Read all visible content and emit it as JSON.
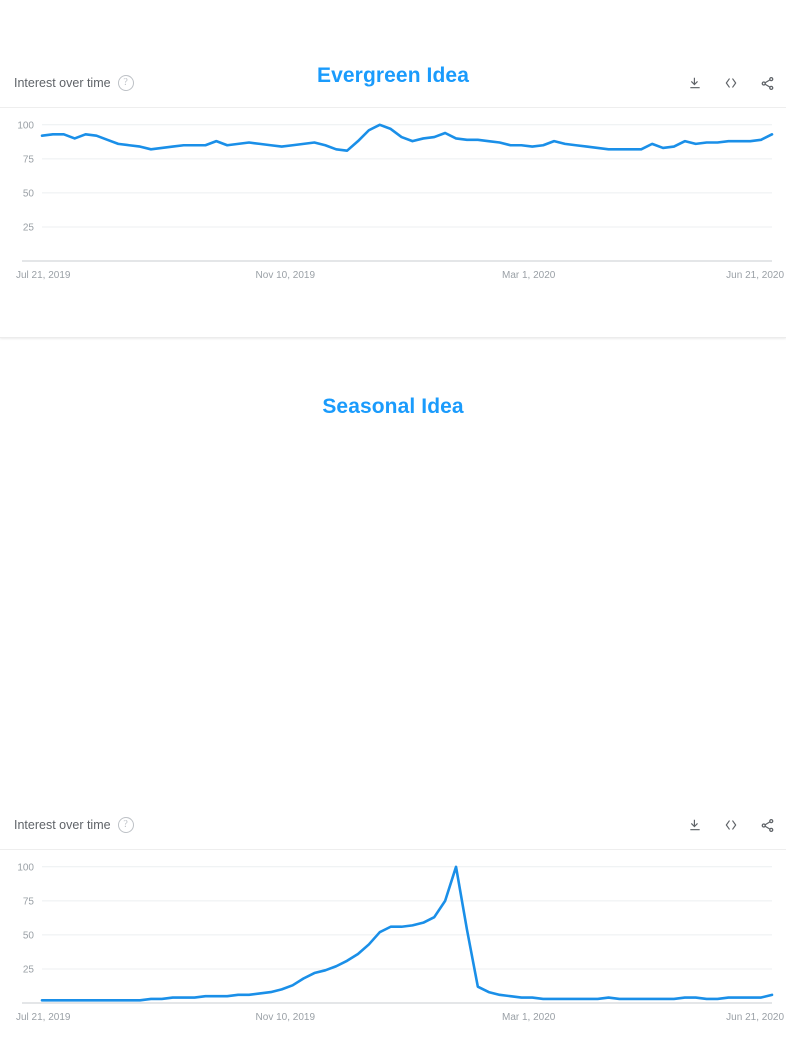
{
  "panels": [
    {
      "title": "Evergreen Idea",
      "header": {
        "label": "Interest over time",
        "help_icon": "help-circle-icon",
        "help_glyph": "?",
        "tools": [
          {
            "name": "download-icon",
            "label": "Download"
          },
          {
            "name": "embed-code-icon",
            "label": "Embed"
          },
          {
            "name": "share-icon",
            "label": "Share"
          }
        ]
      }
    },
    {
      "title": "Seasonal Idea",
      "header": {
        "label": "Interest over time",
        "help_icon": "help-circle-icon",
        "help_glyph": "?",
        "tools": [
          {
            "name": "download-icon",
            "label": "Download"
          },
          {
            "name": "embed-code-icon",
            "label": "Embed"
          },
          {
            "name": "share-icon",
            "label": "Share"
          }
        ]
      }
    }
  ],
  "colors": {
    "title": "#1a9bfc",
    "line": "#1a8fe8",
    "grid": "#eceff1",
    "tick_text": "#9aa0a6",
    "label_text": "#5f6368"
  },
  "chart_data": [
    {
      "type": "line",
      "title": "Evergreen Idea",
      "subtitle": "Interest over time",
      "xlabel": "",
      "ylabel": "",
      "ylim": [
        0,
        105
      ],
      "yticks": [
        25,
        50,
        75,
        100
      ],
      "grid": true,
      "legend": "none",
      "xtick_labels": [
        "Jul 21, 2019",
        "Nov 10, 2019",
        "Mar 1, 2020",
        "Jun 21, 2020"
      ],
      "xtick_positions": [
        0,
        0.3333,
        0.6667,
        1.0
      ],
      "series": [
        {
          "name": "Evergreen Idea",
          "values": [
            92,
            93,
            93,
            90,
            93,
            92,
            89,
            86,
            85,
            84,
            82,
            83,
            84,
            85,
            85,
            85,
            88,
            85,
            86,
            87,
            86,
            85,
            84,
            85,
            86,
            87,
            85,
            82,
            81,
            88,
            96,
            100,
            97,
            91,
            88,
            90,
            91,
            94,
            90,
            89,
            89,
            88,
            87,
            85,
            85,
            84,
            85,
            88,
            86,
            85,
            84,
            83,
            82,
            82,
            82,
            82,
            86,
            83,
            84,
            88,
            86,
            87,
            87,
            88,
            88,
            88,
            89,
            93
          ]
        }
      ]
    },
    {
      "type": "line",
      "title": "Seasonal Idea",
      "subtitle": "Interest over time",
      "xlabel": "",
      "ylabel": "",
      "ylim": [
        0,
        105
      ],
      "yticks": [
        25,
        50,
        75,
        100
      ],
      "grid": true,
      "legend": "none",
      "xtick_labels": [
        "Jul 21, 2019",
        "Nov 10, 2019",
        "Mar 1, 2020",
        "Jun 21, 2020"
      ],
      "xtick_positions": [
        0,
        0.3333,
        0.6667,
        1.0
      ],
      "series": [
        {
          "name": "Seasonal Idea",
          "values": [
            2,
            2,
            2,
            2,
            2,
            2,
            2,
            2,
            2,
            2,
            3,
            3,
            4,
            4,
            4,
            5,
            5,
            5,
            6,
            6,
            7,
            8,
            10,
            13,
            18,
            22,
            24,
            27,
            31,
            36,
            43,
            52,
            56,
            56,
            57,
            59,
            63,
            75,
            100,
            54,
            12,
            8,
            6,
            5,
            4,
            4,
            3,
            3,
            3,
            3,
            3,
            3,
            4,
            3,
            3,
            3,
            3,
            3,
            3,
            4,
            4,
            3,
            3,
            4,
            4,
            4,
            4,
            6
          ]
        }
      ]
    }
  ]
}
